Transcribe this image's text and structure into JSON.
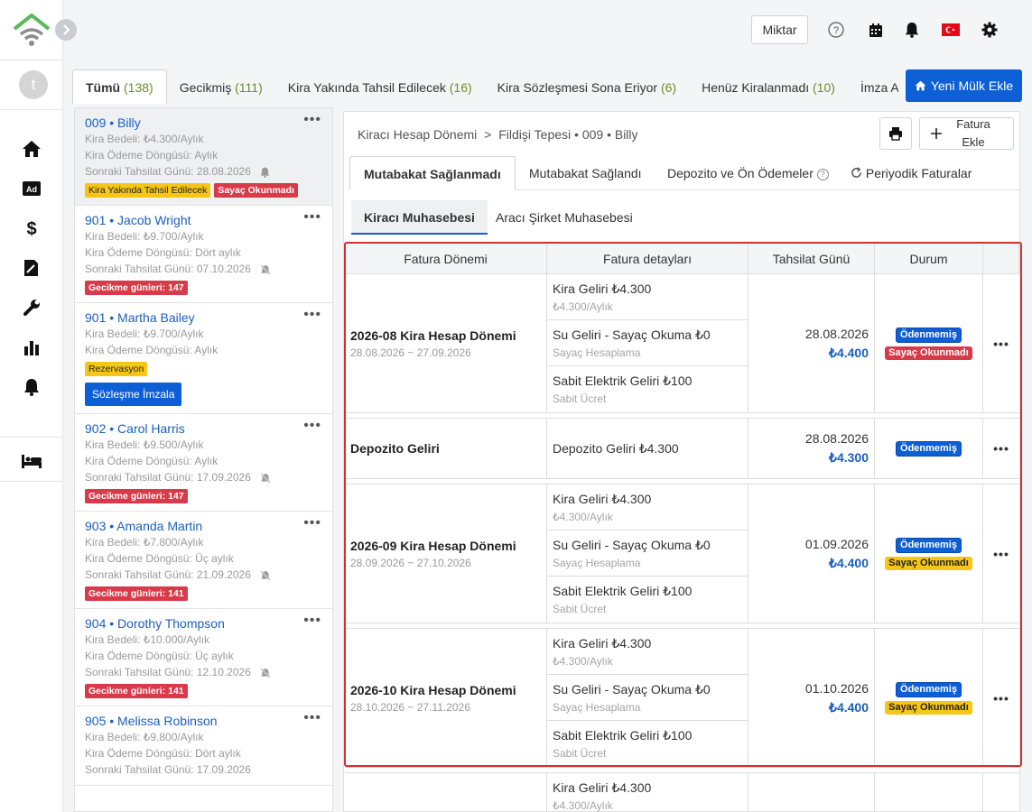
{
  "topbar": {
    "miktar": "Miktar"
  },
  "user": {
    "initial": "t"
  },
  "tabs": [
    {
      "label": "Tümü",
      "count": "(138)"
    },
    {
      "label": "Gecikmiş",
      "count": "(111)"
    },
    {
      "label": "Kira Yakında Tahsil Edilecek",
      "count": "(16)"
    },
    {
      "label": "Kira Sözleşmesi Sona Eriyor",
      "count": "(6)"
    },
    {
      "label": "Henüz Kiralanmadı",
      "count": "(10)"
    },
    {
      "label": "İmza Aşan",
      "count": ""
    }
  ],
  "new_property": "Yeni Mülk Ekle",
  "tenants": [
    {
      "unit": "009",
      "name": "Billy",
      "rent": "Kira Bedeli: ₺4.300/Aylık",
      "cycle": "Kira Ödeme Döngüsü: Aylık",
      "next": "Sonraki Tahsilat Günü:  28.08.2026",
      "badge1": "Kira Yakında Tahsil Edilecek",
      "badge2": "Sayaç Okunmadı"
    },
    {
      "unit": "901",
      "name": "Jacob Wright",
      "rent": "Kira Bedeli: ₺9.700/Aylık",
      "cycle": "Kira Ödeme Döngüsü: Dört aylık",
      "next": "Sonraki Tahsilat Günü:  07.10.2026",
      "badge": "Gecikme günleri: 147"
    },
    {
      "unit": "901",
      "name": "Martha Bailey",
      "rent": "Kira Bedeli: ₺9.700/Aylık",
      "cycle": "Kira Ödeme Döngüsü: Aylık",
      "badge": "Rezervasyon",
      "button": "Sözleşme İmzala"
    },
    {
      "unit": "902",
      "name": "Carol Harris",
      "rent": "Kira Bedeli: ₺9.500/Aylık",
      "cycle": "Kira Ödeme Döngüsü: Aylık",
      "next": "Sonraki Tahsilat Günü:  17.09.2026",
      "badge": "Gecikme günleri: 147"
    },
    {
      "unit": "903",
      "name": "Amanda Martin",
      "rent": "Kira Bedeli: ₺7.800/Aylık",
      "cycle": "Kira Ödeme Döngüsü: Üç aylık",
      "next": "Sonraki Tahsilat Günü:  21.09.2026",
      "badge": "Gecikme günleri: 141"
    },
    {
      "unit": "904",
      "name": "Dorothy Thompson",
      "rent": "Kira Bedeli: ₺10.000/Aylık",
      "cycle": "Kira Ödeme Döngüsü: Üç aylık",
      "next": "Sonraki Tahsilat Günü:  12.10.2026",
      "badge": "Gecikme günleri: 141"
    },
    {
      "unit": "905",
      "name": "Melissa Robinson",
      "rent": "Kira Bedeli: ₺9.800/Aylık",
      "cycle": "Kira Ödeme Döngüsü: Dört aylık",
      "next": "Sonraki Tahsilat Günü:  17.09.2026"
    }
  ],
  "breadcrumb": {
    "root": "Kiracı Hesap Dönemi",
    "sep": ">",
    "path": "Fildişi Tepesi • 009 • Billy"
  },
  "fatura_ekle": "Fatura Ekle",
  "subtabs": [
    "Mutabakat Sağlanmadı",
    "Mutabakat Sağlandı",
    "Depozito ve Ön Ödemeler",
    "Periyodik Faturalar"
  ],
  "acct_tabs": [
    "Kiracı Muhasebesi",
    "Aracı Şirket Muhasebesi"
  ],
  "table": {
    "headers": [
      "Fatura Dönemi",
      "Fatura detayları",
      "Tahsilat Günü",
      "Durum"
    ],
    "groups": [
      {
        "title": "2026-08 Kira Hesap Dönemi",
        "range": "28.08.2026 ~ 27.09.2026",
        "date": "28.08.2026",
        "amount": "₺4.400",
        "status": [
          "Ödenmemiş",
          "Sayaç Okunmadı"
        ],
        "details": [
          {
            "main": "Kira Geliri  ₺4.300",
            "sub": "₺4.300/Aylık"
          },
          {
            "main": "Su Geliri - Sayaç Okuma  ₺0",
            "sub": "Sayaç Hesaplama"
          },
          {
            "main": "Sabit Elektrik Geliri  ₺100",
            "sub": "Sabit Ücret"
          }
        ]
      },
      {
        "title": "Depozito Geliri",
        "date": "28.08.2026",
        "amount": "₺4.300",
        "status": [
          "Ödenmemiş"
        ],
        "details": [
          {
            "main": "Depozito Geliri  ₺4.300"
          }
        ]
      },
      {
        "title": "2026-09 Kira Hesap Dönemi",
        "range": "28.09.2026 ~ 27.10.2026",
        "date": "01.09.2026",
        "amount": "₺4.400",
        "status": [
          "Ödenmemiş",
          "Sayaç Okunmadı"
        ],
        "details": [
          {
            "main": "Kira Geliri  ₺4.300",
            "sub": "₺4.300/Aylık"
          },
          {
            "main": "Su Geliri - Sayaç Okuma  ₺0",
            "sub": "Sayaç Hesaplama"
          },
          {
            "main": "Sabit Elektrik Geliri  ₺100",
            "sub": "Sabit Ücret"
          }
        ]
      },
      {
        "title": "2026-10 Kira Hesap Dönemi",
        "range": "28.10.2026 ~ 27.11.2026",
        "date": "01.10.2026",
        "amount": "₺4.400",
        "status": [
          "Ödenmemiş",
          "Sayaç Okunmadı"
        ],
        "details": [
          {
            "main": "Kira Geliri  ₺4.300",
            "sub": "₺4.300/Aylık"
          },
          {
            "main": "Su Geliri - Sayaç Okuma  ₺0",
            "sub": "Sayaç Hesaplama"
          },
          {
            "main": "Sabit Elektrik Geliri  ₺100",
            "sub": "Sabit Ücret"
          }
        ]
      },
      {
        "details": [
          {
            "main": "Kira Geliri  ₺4.300",
            "sub": "₺4.300/Aylık"
          }
        ]
      }
    ]
  },
  "colors": {
    "primary": "#0d5fd6",
    "danger": "#d93a4a",
    "warning": "#f5c518",
    "highlight": "#d32f2f"
  }
}
